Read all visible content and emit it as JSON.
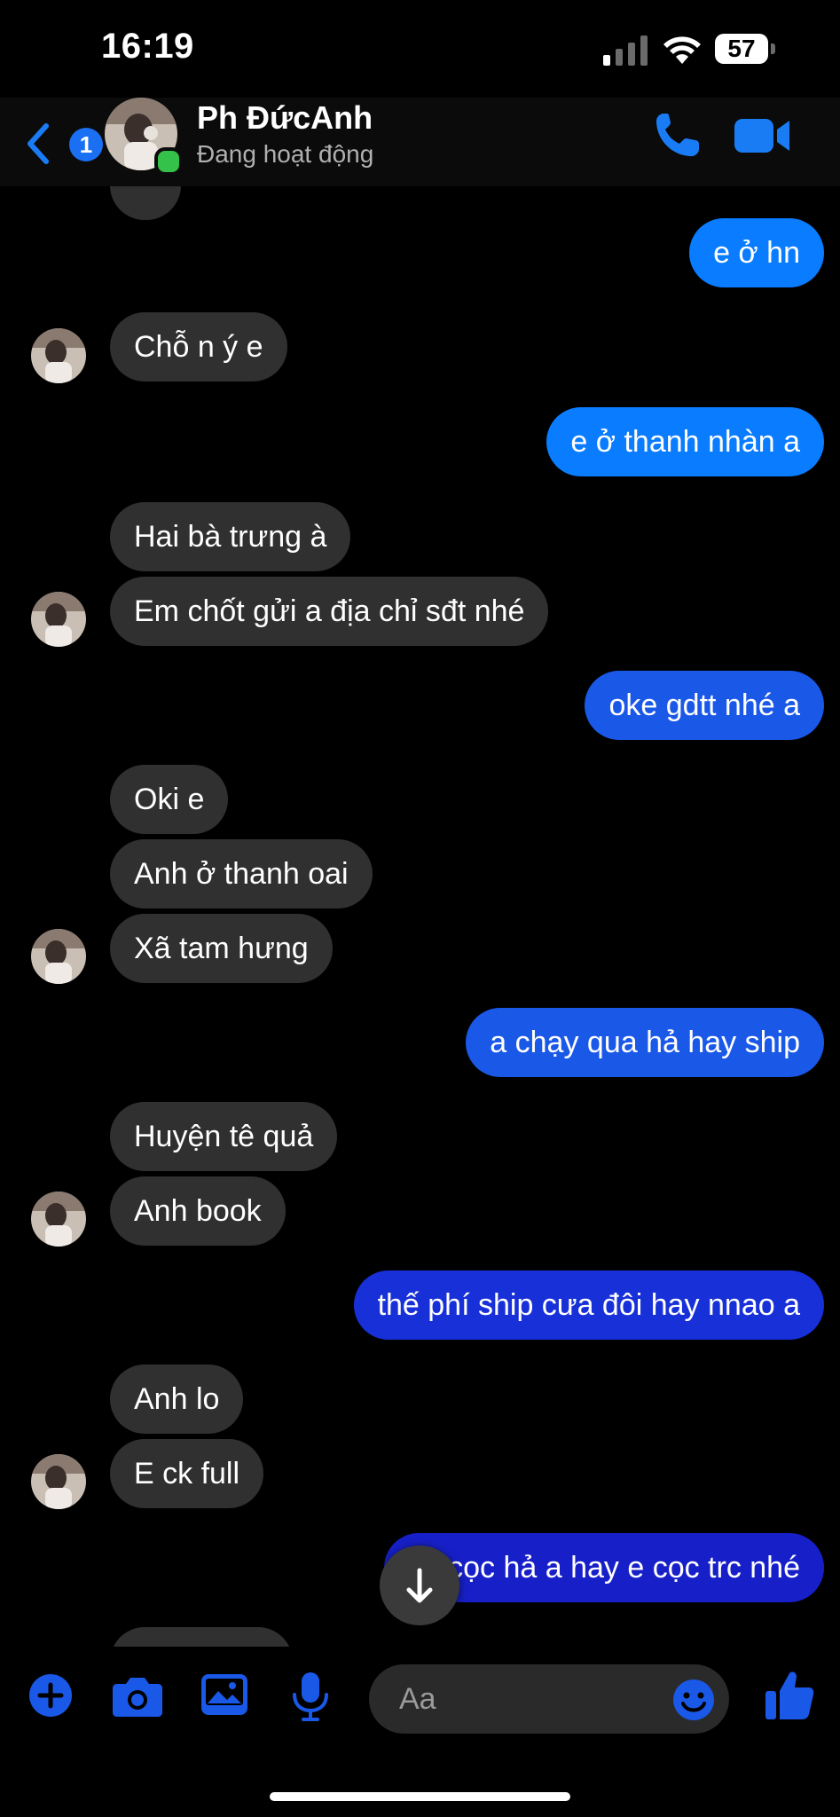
{
  "status_bar": {
    "time": "16:19",
    "battery": "57"
  },
  "header": {
    "back_badge": "1",
    "contact_name": "Ph ĐứcAnh",
    "contact_status": "Đang hoạt động"
  },
  "messages": [
    {
      "dir": "out",
      "text": "e ở hn"
    },
    {
      "dir": "in",
      "text": "Chỗ n ý e"
    },
    {
      "dir": "out",
      "text": "e ở thanh nhàn a"
    },
    {
      "dir": "in",
      "text": "Hai bà trưng à"
    },
    {
      "dir": "in",
      "text": "Em chốt gửi a địa chỉ sđt nhé"
    },
    {
      "dir": "out",
      "text": "oke gdtt nhé a"
    },
    {
      "dir": "in",
      "text": "Oki e"
    },
    {
      "dir": "in",
      "text": "Anh ở thanh oai"
    },
    {
      "dir": "in",
      "text": "Xã tam hưng"
    },
    {
      "dir": "out",
      "text": "a chạy qua hả hay ship"
    },
    {
      "dir": "in",
      "text": "Huyện tê quả"
    },
    {
      "dir": "in",
      "text": "Anh book"
    },
    {
      "dir": "out",
      "text": "thế phí ship cưa đôi hay nnao a"
    },
    {
      "dir": "in",
      "text": "Anh lo"
    },
    {
      "dir": "in",
      "text": "E ck full"
    },
    {
      "dir": "out",
      "text": "ko cọc hả a hay e cọc trc nhé"
    }
  ],
  "composer": {
    "placeholder": "Aa"
  },
  "colors": {
    "accent": "#0a7cff",
    "incoming_bubble": "#303030",
    "online": "#35c24a"
  }
}
